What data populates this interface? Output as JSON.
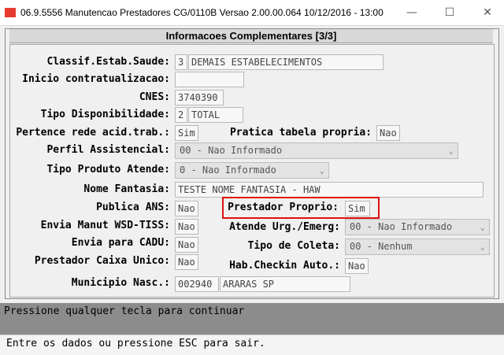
{
  "window": {
    "title": "06.9.5556 Manutencao  Prestadores CG/0110B Versao 2.00.00.064 10/12/2016 - 13:00",
    "minimize_glyph": "—",
    "maximize_glyph": "☐",
    "close_glyph": "✕"
  },
  "form": {
    "header": "Informacoes Complementares [3/3]",
    "classif_label": "Classif.Estab.Saude:",
    "classif_code": "3",
    "classif_desc": "DEMAIS ESTABELECIMENTOS",
    "inicio_label": "Inicio contratualizacao:",
    "inicio_value": "",
    "cnes_label": "CNES:",
    "cnes_value": "3740390",
    "tipo_disp_label": "Tipo Disponibilidade:",
    "tipo_disp_code": "2",
    "tipo_disp_desc": "TOTAL",
    "pertence_label": "Pertence rede acid.trab.:",
    "pertence_value": "Sim",
    "pratica_label": "Pratica tabela propria:",
    "pratica_value": "Nao",
    "perfil_label": "Perfil Assistencial:",
    "perfil_value": "00 - Nao Informado",
    "tipo_prod_label": "Tipo Produto Atende:",
    "tipo_prod_value": "0 - Nao Informado",
    "nome_fantasia_label": "Nome Fantasia:",
    "nome_fantasia_value": "TESTE NOME FANTASIA - HAW",
    "publica_label": "Publica ANS:",
    "publica_value": "Nao",
    "prestador_proprio_label": "Prestador Proprio:",
    "prestador_proprio_value": "Sim",
    "envia_wsd_label": "Envia Manut WSD-TISS:",
    "envia_wsd_value": "Nao",
    "atende_urg_label": "Atende Urg./Emerg:",
    "atende_urg_value": "00 - Nao Informado",
    "envia_cadu_label": "Envia para CADU:",
    "envia_cadu_value": "Nao",
    "tipo_coleta_label": "Tipo de Coleta:",
    "tipo_coleta_value": "00 - Nenhum",
    "caixa_label": "Prestador Caixa Unico:",
    "caixa_value": "Nao",
    "hab_label": "Hab.Checkin Auto.:",
    "hab_value": "Nao",
    "municipio_label": "Municipio Nasc.:",
    "municipio_code": "002940",
    "municipio_name": "ARARAS SP"
  },
  "messages": {
    "prompt": "Pressione qualquer tecla para continuar",
    "status": "Entre os dados ou pressione ESC para sair."
  },
  "colors": {
    "highlight": "#e01010",
    "message_bar": "#8c8c8c"
  }
}
